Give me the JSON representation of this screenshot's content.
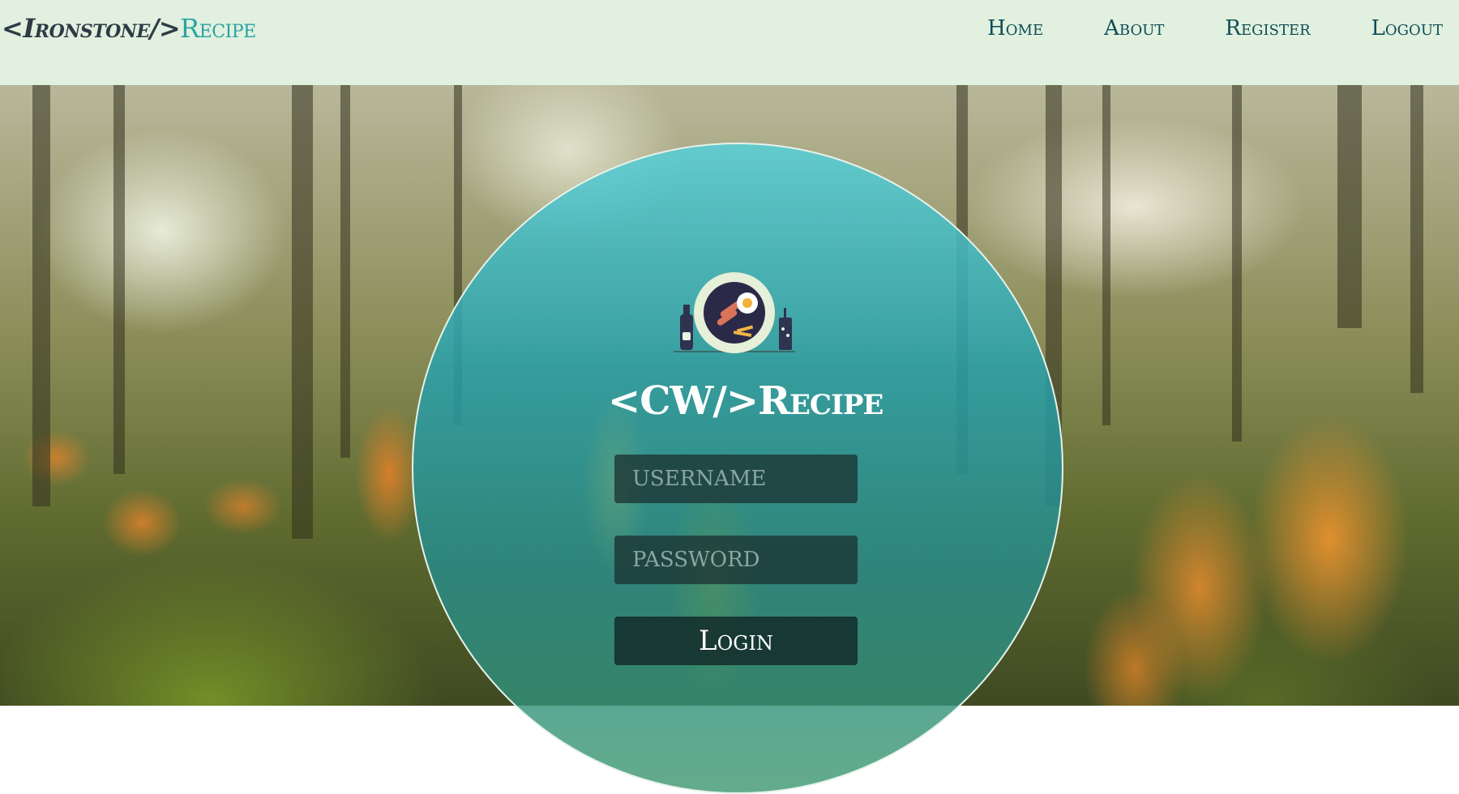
{
  "navbar": {
    "brand_part1": "<Ironstone/>",
    "brand_part2": "Recipe",
    "links": [
      {
        "label": "Home"
      },
      {
        "label": "About"
      },
      {
        "label": "Register"
      },
      {
        "label": "Logout"
      }
    ]
  },
  "login_card": {
    "title": "<CW/>Recipe",
    "username_placeholder": "USERNAME",
    "password_placeholder": "PASSWORD",
    "login_label": "Login",
    "logo_icon": "food-plate-icon"
  },
  "colors": {
    "navbar_bg": "#e1f0df",
    "brand_dark": "#2f3a45",
    "brand_accent": "#2aa3a3",
    "nav_text": "#0f4d57",
    "card_teal": "#2aa3a3"
  }
}
